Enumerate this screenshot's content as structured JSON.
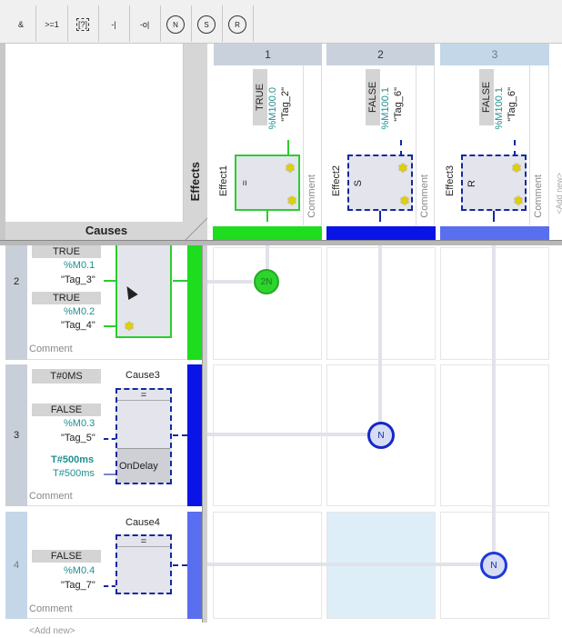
{
  "toolbar": {
    "buttons": [
      "&",
      ">=1",
      "[?]",
      "-|",
      "-o|",
      "N",
      "S",
      "R"
    ]
  },
  "axis_labels": {
    "effects": "Effects",
    "causes": "Causes"
  },
  "effect_columns": [
    {
      "number": "1",
      "name": "Effect1",
      "value": "TRUE",
      "address": "%M100.0",
      "tag": "\"Tag_2\"",
      "instr": "=",
      "comment": "Comment",
      "color": "#1edc1e"
    },
    {
      "number": "2",
      "name": "Effect2",
      "value": "FALSE",
      "address": "%M100.1",
      "tag": "\"Tag_6\"",
      "instr": "S",
      "comment": "Comment",
      "color": "#0a14e6"
    },
    {
      "number": "3",
      "name": "Effect3",
      "value": "FALSE",
      "address": "%M100.1",
      "tag": "\"Tag_6\"",
      "instr": "R",
      "comment": "Comment",
      "color": "#5a6ef0"
    }
  ],
  "add_new_col": "<Add new>",
  "cause_rows": [
    {
      "number": "2",
      "inputs": [
        {
          "value": "TRUE",
          "address": "%M0.1",
          "tag": "\"Tag_3\""
        },
        {
          "value": "TRUE",
          "address": "%M0.2",
          "tag": "\"Tag_4\""
        }
      ],
      "comment": "Comment",
      "color": "#1edc1e",
      "node": "2N"
    },
    {
      "number": "3",
      "name": "Cause3",
      "time_value": "T#0MS",
      "instr": "=",
      "inputs": [
        {
          "value": "FALSE",
          "address": "%M0.3",
          "tag": "\"Tag_5\""
        }
      ],
      "time1": "T#500ms",
      "time2": "T#500ms",
      "delay": "OnDelay",
      "comment": "Comment",
      "color": "#0a14e6",
      "node": "N"
    },
    {
      "number": "4",
      "name": "Cause4",
      "instr": "=",
      "inputs": [
        {
          "value": "FALSE",
          "address": "%M0.4",
          "tag": "\"Tag_7\""
        }
      ],
      "comment": "Comment",
      "color": "#5a6ef0",
      "node": "N"
    }
  ],
  "add_new_row": "<Add new>"
}
